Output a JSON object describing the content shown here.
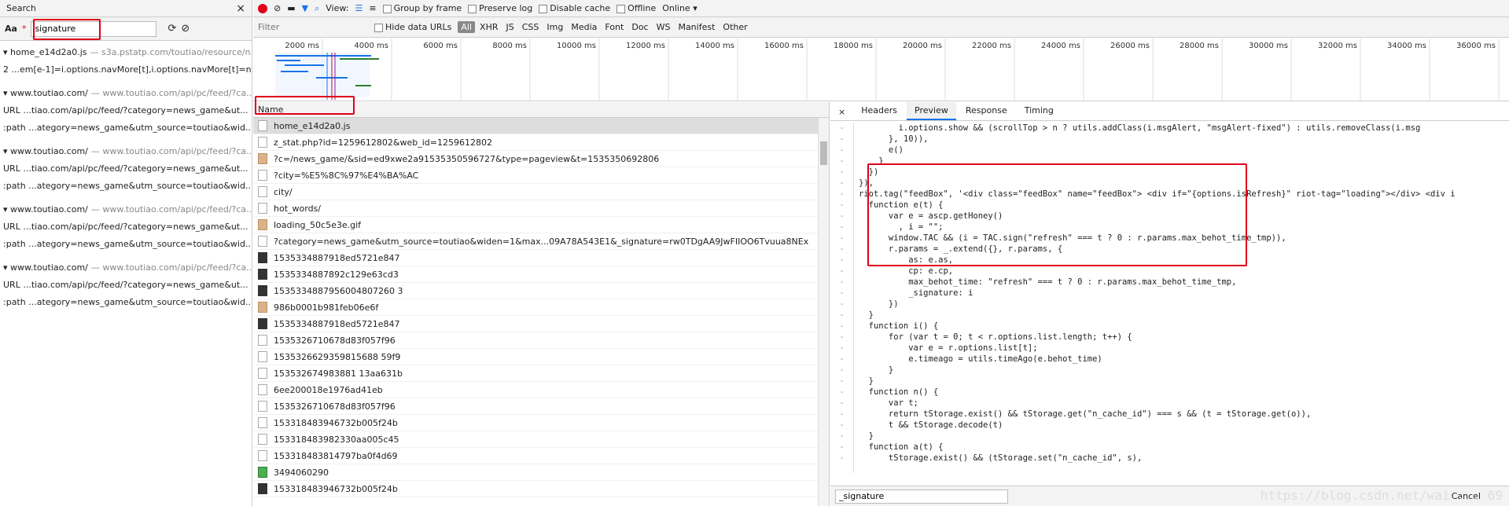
{
  "search": {
    "title": "Search",
    "close": "×",
    "case_label": "Aa",
    "query": "signature",
    "results": [
      {
        "file": "home_e14d2a0.js",
        "origin": "— s3a.pstatp.com/toutiao/resource/n...",
        "line_no": "2",
        "match": "...em[e-1]=i.options.navMore[t],i.options.navMore[t]=n..."
      },
      {
        "file": "www.toutiao.com/",
        "origin": "— www.toutiao.com/api/pc/feed/?ca...",
        "url": "...tiao.com/api/pc/feed/?category=news_game&ut...",
        "path": "...ategory=news_game&utm_source=toutiao&wid..."
      },
      {
        "file": "www.toutiao.com/",
        "origin": "— www.toutiao.com/api/pc/feed/?ca...",
        "url": "...tiao.com/api/pc/feed/?category=news_game&ut...",
        "path": "...ategory=news_game&utm_source=toutiao&wid..."
      },
      {
        "file": "www.toutiao.com/",
        "origin": "— www.toutiao.com/api/pc/feed/?ca...",
        "url": "...tiao.com/api/pc/feed/?category=news_game&ut...",
        "path": "...ategory=news_game&utm_source=toutiao&wid..."
      },
      {
        "file": "www.toutiao.com/",
        "origin": "— www.toutiao.com/api/pc/feed/?ca...",
        "url": "...tiao.com/api/pc/feed/?category=news_game&ut...",
        "path": "...ategory=news_game&utm_source=toutiao&wid..."
      }
    ],
    "url_label": "URL",
    "path_label": ":path"
  },
  "toolbar": {
    "view": "View:",
    "group_by_frame": "Group by frame",
    "preserve_log": "Preserve log",
    "disable_cache": "Disable cache",
    "offline": "Offline",
    "online": "Online"
  },
  "filter": {
    "placeholder": "Filter",
    "hide_data_urls": "Hide data URLs",
    "types": [
      "All",
      "XHR",
      "JS",
      "CSS",
      "Img",
      "Media",
      "Font",
      "Doc",
      "WS",
      "Manifest",
      "Other"
    ]
  },
  "timeline": [
    "2000 ms",
    "4000 ms",
    "6000 ms",
    "8000 ms",
    "10000 ms",
    "12000 ms",
    "14000 ms",
    "16000 ms",
    "18000 ms",
    "20000 ms",
    "22000 ms",
    "24000 ms",
    "26000 ms",
    "28000 ms",
    "30000 ms",
    "32000 ms",
    "34000 ms",
    "36000 ms"
  ],
  "list": {
    "header": "Name",
    "rows": [
      "home_e14d2a0.js",
      "z_stat.php?id=1259612802&web_id=1259612802",
      "?c=/news_game/&sid=ed9xwe2a91535350596727&type=pageview&t=1535350692806",
      "?city=%E5%8C%97%E4%BA%AC",
      "city/",
      "hot_words/",
      "loading_50c5e3e.gif",
      "?category=news_game&utm_source=toutiao&widen=1&max...09A78A543E1&_signature=rw0TDgAA9JwFIIOO6Tvuua8NEx",
      "1535334887918ed5721e847",
      "1535334887892c129e63cd3",
      "1535334887956004807260 3",
      "986b0001b981feb06e6f",
      "1535334887918ed5721e847",
      "1535326710678d83f057f96",
      "1535326629359815688 59f9",
      "153532674983881 13aa631b",
      "6ee200018e1976ad41eb",
      "1535326710678d83f057f96",
      "153318483946732b005f24b",
      "153318483982330aa005c45",
      "153318483814797ba0f4d69",
      "3494060290",
      "153318483946732b005f24b"
    ]
  },
  "detail": {
    "close": "×",
    "tabs": [
      "Headers",
      "Preview",
      "Response",
      "Timing"
    ],
    "code": [
      "        i.options.show && (scrollTop > n ? utils.addClass(i.msgAlert, \"msgAlert-fixed\") : utils.removeClass(i.msg",
      "      }, 10)),",
      "      e()",
      "    }",
      "  })",
      "}),",
      "riot.tag(\"feedBox\", '<div class=\"feedBox\" name=\"feedBox\"> <div if=\"{options.isRefresh}\" riot-tag=\"loading\"></div> <div i",
      "  function e(t) {",
      "      var e = ascp.getHoney()",
      "        , i = \"\";",
      "      window.TAC && (i = TAC.sign(\"refresh\" === t ? 0 : r.params.max_behot_time_tmp)),",
      "      r.params = _.extend({}, r.params, {",
      "          as: e.as,",
      "          cp: e.cp,",
      "          max_behot_time: \"refresh\" === t ? 0 : r.params.max_behot_time_tmp,",
      "          _signature: i",
      "      })",
      "  }",
      "  function i() {",
      "      for (var t = 0; t < r.options.list.length; t++) {",
      "          var e = r.options.list[t];",
      "          e.timeago = utils.timeAgo(e.behot_time)",
      "      }",
      "  }",
      "  function n() {",
      "      var t;",
      "      return tStorage.exist() && tStorage.get(\"n_cache_id\") === s && (t = tStorage.get(o)),",
      "      t && tStorage.decode(t)",
      "  }",
      "  function a(t) {",
      "      tStorage.exist() && (tStorage.set(\"n_cache_id\", s),"
    ],
    "find_value": "_signature",
    "cancel": "Cancel",
    "watermark": "https://blog.csdn.net/wai ... 69"
  }
}
